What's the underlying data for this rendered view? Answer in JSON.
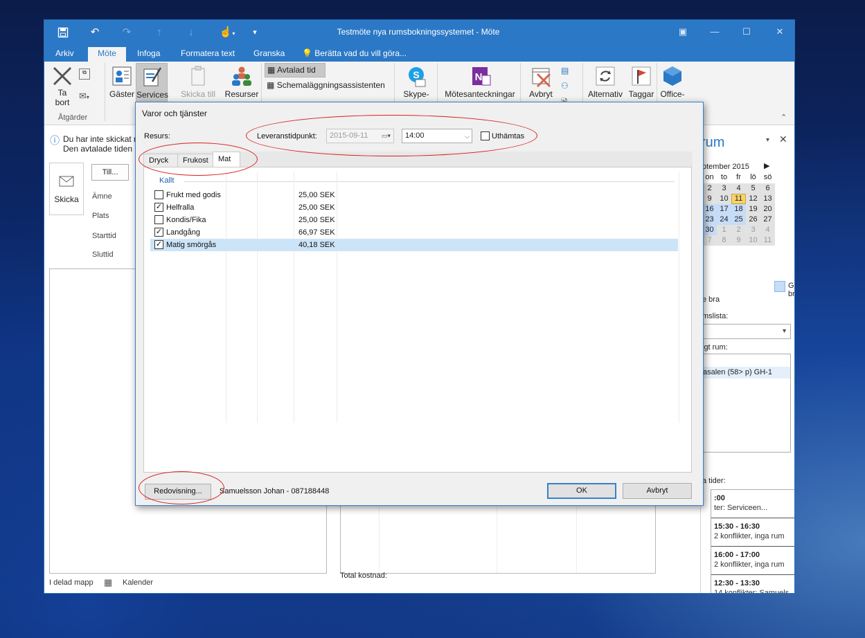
{
  "window": {
    "title": "Testmöte nya rumsbokningssystemet - Möte",
    "tabs": [
      "Arkiv",
      "Möte",
      "Infoga",
      "Formatera text",
      "Granska"
    ],
    "tell_me": "Berätta vad du vill göra..."
  },
  "ribbon": {
    "delete_label": "Ta bort",
    "delete_line1": "Ta",
    "delete_line2": "bort",
    "group_actions": "Åtgärder",
    "guests": "Gäster",
    "services": "Services",
    "send_to": "Skicka till",
    "resources": "Resurser",
    "appointment": "Avtalad tid",
    "scheduling": "Schemaläggningsassistenten",
    "skype": "Skype-",
    "meeting_notes": "Mötesanteckningar",
    "cancel": "Avbryt",
    "options": "Alternativ",
    "tags": "Taggar",
    "office": "Office-"
  },
  "meeting_form": {
    "info_line1": "Du har inte skickat m",
    "info_line2": "Den avtalade tiden k",
    "send": "Skicka",
    "to": "Till...",
    "subject": "Ämne",
    "location": "Plats",
    "start": "Starttid",
    "end": "Sluttid",
    "shared_folder": "I delad mapp",
    "calendar": "Kalender",
    "total_cost": "Total kostnad:"
  },
  "room_pane": {
    "title": "rum",
    "month": "ptember 2015",
    "weekdays": [
      "on",
      "to",
      "fr",
      "lö",
      "sö"
    ],
    "weeks": [
      [
        "2",
        "3",
        "4",
        "5",
        "6"
      ],
      [
        "9",
        "10",
        "11",
        "12",
        "13"
      ],
      [
        "16",
        "17",
        "18",
        "19",
        "20"
      ],
      [
        "23",
        "24",
        "25",
        "26",
        "27"
      ],
      [
        "30",
        "1",
        "2",
        "3",
        "4"
      ],
      [
        "7",
        "8",
        "9",
        "10",
        "11"
      ]
    ],
    "legend_fair": "Ganska bra",
    "legend_good": "e bra",
    "room_list_label": "mslista:",
    "free_room_label": "igt rum:",
    "room_item": "asalen (58> p) GH-1",
    "times_label": "a tider:",
    "suggestions": [
      {
        "time": ":00",
        "detail": "ter: Serviceen..."
      },
      {
        "time": "15:30 - 16:30",
        "detail": "2 konflikter, inga rum"
      },
      {
        "time": "16:00 - 17:00",
        "detail": "2 konflikter, inga rum"
      },
      {
        "time": "12:30 - 13:30",
        "detail": "14 konflikter: Samuels..."
      }
    ]
  },
  "dialog": {
    "title": "Varor och tjänster",
    "resource_label": "Resurs:",
    "delivery_label": "Leveranstidpunkt:",
    "delivery_date": "2015-09-11",
    "delivery_time": "14:00",
    "pickup_label": "Uthämtas",
    "pickup_checked": false,
    "tabs": [
      "Dryck",
      "Frukost",
      "Mat"
    ],
    "active_tab": "Mat",
    "category": "Kallt",
    "items": [
      {
        "name": "Frukt med godis",
        "price": "25,00 SEK",
        "checked": false,
        "selected": false
      },
      {
        "name": "Helfralla",
        "price": "25,00 SEK",
        "checked": true,
        "selected": false
      },
      {
        "name": "Kondis/Fika",
        "price": "25,00 SEK",
        "checked": false,
        "selected": false
      },
      {
        "name": "Landgång",
        "price": "66,97 SEK",
        "checked": true,
        "selected": false
      },
      {
        "name": "Matig smörgås",
        "price": "40,18 SEK",
        "checked": true,
        "selected": true
      }
    ],
    "accounting_button": "Redovisning...",
    "contact": "Samuelsson Johan - 087188448",
    "ok": "OK",
    "cancel": "Avbryt"
  },
  "colors": {
    "titlebar": "#2b78c6",
    "selection": "#cce4f7",
    "annotation": "#d71e1e",
    "today": "#f7d36b"
  }
}
